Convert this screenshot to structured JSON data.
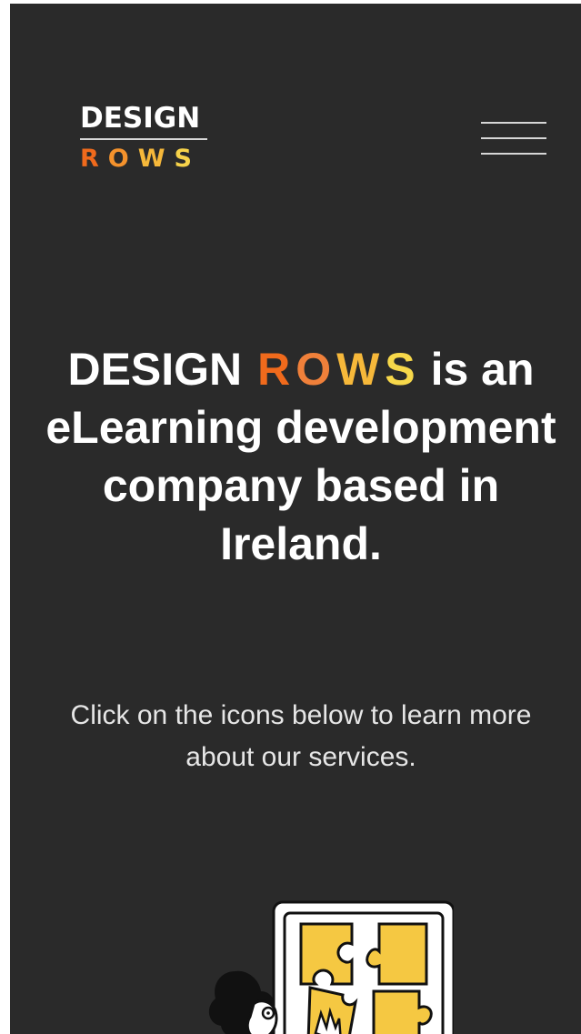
{
  "brand": {
    "line1": "DESIGN",
    "line2_letters": [
      "R",
      "O",
      "W",
      "S"
    ],
    "line2_colors": [
      "#f06a1c",
      "#f4922c",
      "#f6b83a",
      "#f7d34a"
    ]
  },
  "nav": {
    "menu_icon": "hamburger-icon"
  },
  "hero": {
    "lead": "DESIGN",
    "rows_letters": [
      "R",
      "O",
      "W",
      "S"
    ],
    "rows_colors": [
      "#f06a1c",
      "#f0803a",
      "#f6b83a",
      "#f7d84a"
    ],
    "rest": "is an eLearning development company based in Ireland."
  },
  "subtitle": "Click on the icons below to learn more about our services.",
  "illustration": {
    "icon": "puzzle-person-illustration",
    "accent": "#f5c842"
  }
}
